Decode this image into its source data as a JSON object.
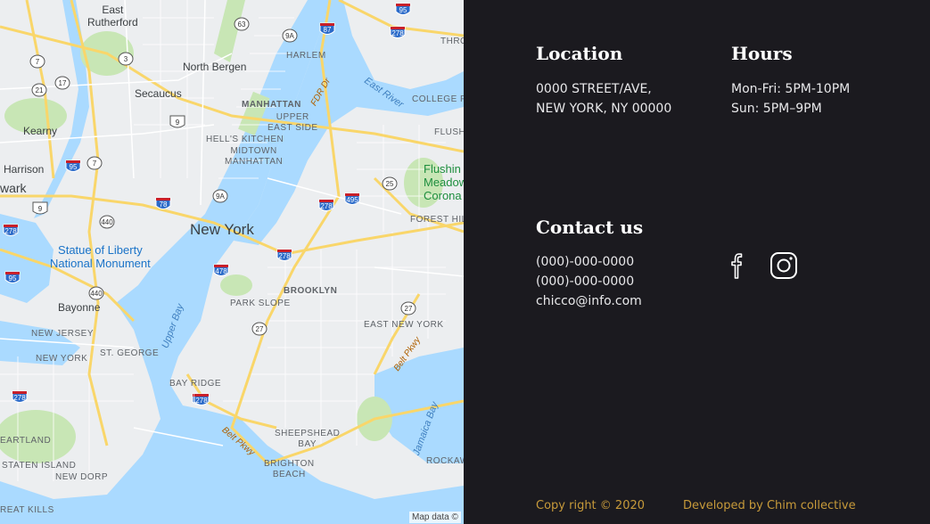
{
  "map": {
    "labels": {
      "east_rutherford": "East\nRutherford",
      "north_bergen": "North Bergen",
      "secaucus": "Secaucus",
      "kearny": "Kearny",
      "harrison": "Harrison",
      "newark": "wark",
      "harlem": "HARLEM",
      "manhattan": "MANHATTAN",
      "upper_east_side": "UPPER\nEAST SIDE",
      "hells_kitchen": "HELL'S KITCHEN",
      "midtown": "MIDTOWN\nMANHATTAN",
      "new_york": "New York",
      "statue_of_liberty": "Statue of Liberty\nNational Monument",
      "bayonne": "Bayonne",
      "new_jersey": "NEW JERSEY",
      "new_york_small": "NEW YORK",
      "st_george": "ST. GEORGE",
      "brooklyn": "BROOKLYN",
      "park_slope": "PARK SLOPE",
      "east_new_york": "EAST NEW YORK",
      "bay_ridge": "BAY RIDGE",
      "sheepshead_bay": "SHEEPSHEAD\nBAY",
      "brighton_beach": "BRIGHTON\nBEACH",
      "eartland": "EARTLAND",
      "staten_island": "STATEN ISLAND",
      "new_dorp": "NEW DORP",
      "great_kills": "REAT KILLS",
      "flushing": "Flushin\nMeadow\nCorona P",
      "college_point": "COLLEGE P",
      "flush": "FLUSH",
      "forest_hill": "FOREST HIL",
      "rockaway": "ROCKAW",
      "east_river": "East River",
      "upper_bay": "Upper Bay",
      "jamaica_bay": "Jamaica Bay",
      "fdr_dr": "FDR Dr",
      "belt_pkwy_1": "Belt Pkwy",
      "belt_pkwy_2": "Belt Pkwy",
      "belt_pkwy_3": "Belt Pkwy",
      "thro": "THRO"
    },
    "route_shields": [
      "63",
      "9A",
      "3",
      "7",
      "21",
      "17",
      "9",
      "95",
      "7",
      "440",
      "9",
      "78",
      "9A",
      "440",
      "95",
      "278",
      "478",
      "278",
      "27",
      "25",
      "495",
      "278",
      "87",
      "95",
      "278",
      "278",
      "278",
      "27",
      "278"
    ],
    "attribution": "Map data ©"
  },
  "location": {
    "heading": "Location",
    "line1": "0000 STREET/AVE,",
    "line2": "NEW YORK, NY 00000"
  },
  "hours": {
    "heading": "Hours",
    "line1": "Mon-Fri: 5PM-10PM",
    "line2": "Sun: 5PM–9PM"
  },
  "contact": {
    "heading": "Contact us",
    "phone1": "(000)-000-0000",
    "phone2": "(000)-000-0000",
    "email": "chicco@info.com"
  },
  "social": {
    "facebook_icon": "facebook-icon",
    "instagram_icon": "instagram-icon"
  },
  "footer": {
    "copyright": "Copy right © 2020",
    "developed_by": "Developed by Chim collective"
  },
  "colors": {
    "panel_bg": "#1b1a1f",
    "footer_text": "#c79a3a",
    "water": "#aadaff",
    "park": "#c8e6b5",
    "highway": "#f9d66a"
  }
}
